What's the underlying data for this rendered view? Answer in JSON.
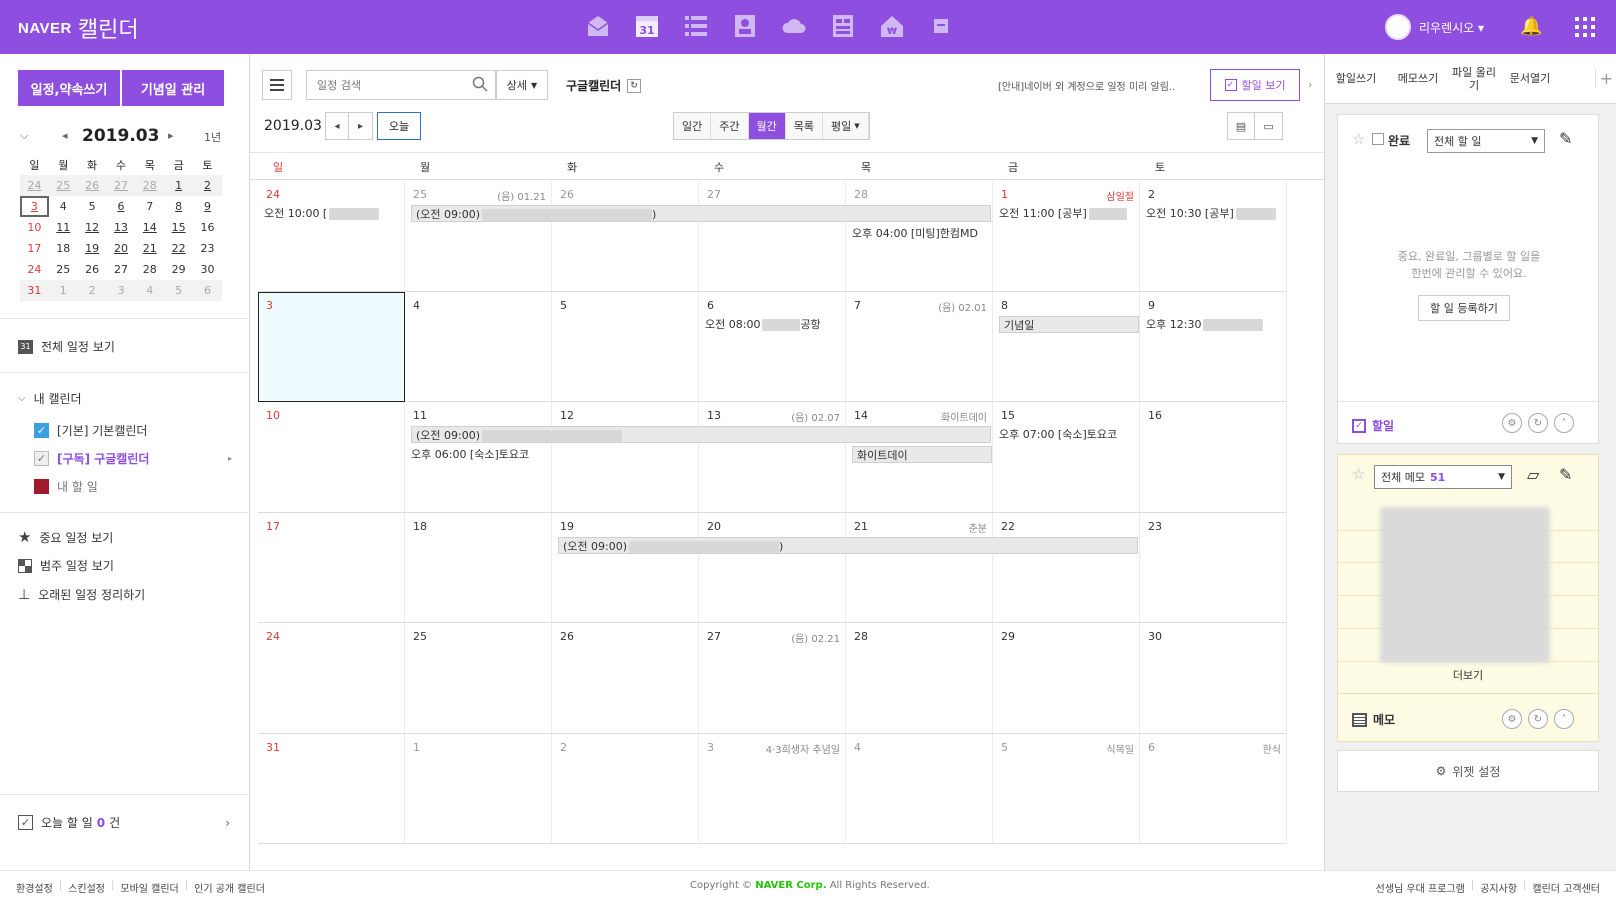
{
  "topbar": {
    "logo_brand": "NAVER",
    "logo_product": "캘린더",
    "user_name": "리우렌시오 ▾",
    "apps": [
      "mail-icon",
      "calendar-icon",
      "list-icon",
      "contacts-icon",
      "cloud-icon",
      "board-icon",
      "house-icon",
      "note-icon"
    ],
    "calendar_app_day": "31"
  },
  "left": {
    "write_btn": "일정,약속쓰기",
    "anniv_btn": "기념일 관리",
    "mini": {
      "title": "2019.03",
      "year_btn": "1년",
      "weekdays": [
        "일",
        "월",
        "화",
        "수",
        "목",
        "금",
        "토"
      ],
      "weeks": [
        [
          "24",
          "25",
          "26",
          "27",
          "28",
          "1",
          "2"
        ],
        [
          "3",
          "4",
          "5",
          "6",
          "7",
          "8",
          "9"
        ],
        [
          "10",
          "11",
          "12",
          "13",
          "14",
          "15",
          "16"
        ],
        [
          "17",
          "18",
          "19",
          "20",
          "21",
          "22",
          "23"
        ],
        [
          "24",
          "25",
          "26",
          "27",
          "28",
          "29",
          "30"
        ],
        [
          "31",
          "1",
          "2",
          "3",
          "4",
          "5",
          "6"
        ]
      ]
    },
    "all_view": "전체 일정 보기",
    "my_calendars": "내 캘린더",
    "cal_basic": "[기본] 기본캘린더",
    "cal_google": "[구독] 구글캘린더",
    "cal_todo": "내 할 일",
    "important": "중요 일정 보기",
    "category": "범주 일정 보기",
    "cleanup": "오래된 일정 정리하기",
    "today_todo_prefix": "오늘 할 일",
    "today_todo_count": "0",
    "today_todo_suffix": "건"
  },
  "main": {
    "search_placeholder": "일정 검색",
    "detail": "상세",
    "calendar_name": "구글캘린더",
    "notice": "[안내]네이버 외 계정으로 일정 미리 알림..",
    "todo_view": "할일 보기",
    "date_label": "2019.03",
    "today": "오늘",
    "views": [
      "일간",
      "주간",
      "월간",
      "목록",
      "평일"
    ],
    "active_view": "월간",
    "weekdays": [
      "일",
      "월",
      "화",
      "수",
      "목",
      "금",
      "토"
    ],
    "weeks": [
      [
        "24",
        "25",
        "26",
        "27",
        "28",
        "1",
        "2"
      ],
      [
        "3",
        "4",
        "5",
        "6",
        "7",
        "8",
        "9"
      ],
      [
        "10",
        "11",
        "12",
        "13",
        "14",
        "15",
        "16"
      ],
      [
        "17",
        "18",
        "19",
        "20",
        "21",
        "22",
        "23"
      ],
      [
        "24",
        "25",
        "26",
        "27",
        "28",
        "29",
        "30"
      ],
      [
        "31",
        "1",
        "2",
        "3",
        "4",
        "5",
        "6"
      ]
    ],
    "holidays": {
      "w0_mon": "(음) 01.21",
      "w0_fri": "삼일절",
      "w1_thu": "(음) 02.01",
      "w2_wed": "(음) 02.07",
      "w2_thu": "화이트데이",
      "w3_thu": "춘분",
      "w4_wed": "(음) 02.21",
      "w5_wed": "4·3희생자 추념일",
      "w5_fri": "식목일",
      "w5_sat": "한식"
    },
    "events": {
      "e1": "오전 10:00 [",
      "e2": "(오전 09:00)",
      "e2_tail": ")",
      "e3": "오전 11:00 [공부]",
      "e4": "오전 10:30 [공부]",
      "e5": "오후 04:00 [미팅]한컴MD",
      "e6": "오전 08:00",
      "e6_tail": "공항",
      "e7": "기념일",
      "e8": "오후 12:30",
      "e9": "(오전 09:00)",
      "e10": "오후 07:00 [숙소]토요코",
      "e11": "오후 06:00 [숙소]토요코",
      "e12": "화이트데이",
      "e13": "(오전 09:00)",
      "e13_tail": ")"
    }
  },
  "right": {
    "tabs": [
      "할일쓰기",
      "메모쓰기",
      "파일 올리기",
      "문서열기"
    ],
    "done": "완료",
    "todo_filter": "전체 할 일",
    "empty_line1": "중요, 완료일, 그룹별로 할 일을",
    "empty_line2": "한번에 관리할 수 있어요.",
    "register": "할 일 등록하기",
    "todo_title": "할일",
    "memo_filter": "전체 메모",
    "memo_count": "51",
    "more": "더보기",
    "memo_title": "메모",
    "widget_settings": "위젯 설정"
  },
  "footer": {
    "links_left": [
      "환경설정",
      "스킨설정",
      "모바일 캘린더",
      "인기 공개 캘린더"
    ],
    "copyright_prefix": "Copyright ©",
    "copyright_brand": "NAVER Corp.",
    "copyright_suffix": "All Rights Reserved.",
    "links_right": [
      "선생님 우대 프로그램",
      "공지사항",
      "캘린더 고객센터"
    ]
  },
  "colors": {
    "accent": "#8e4fe0",
    "sunday": "#e03a3a"
  }
}
